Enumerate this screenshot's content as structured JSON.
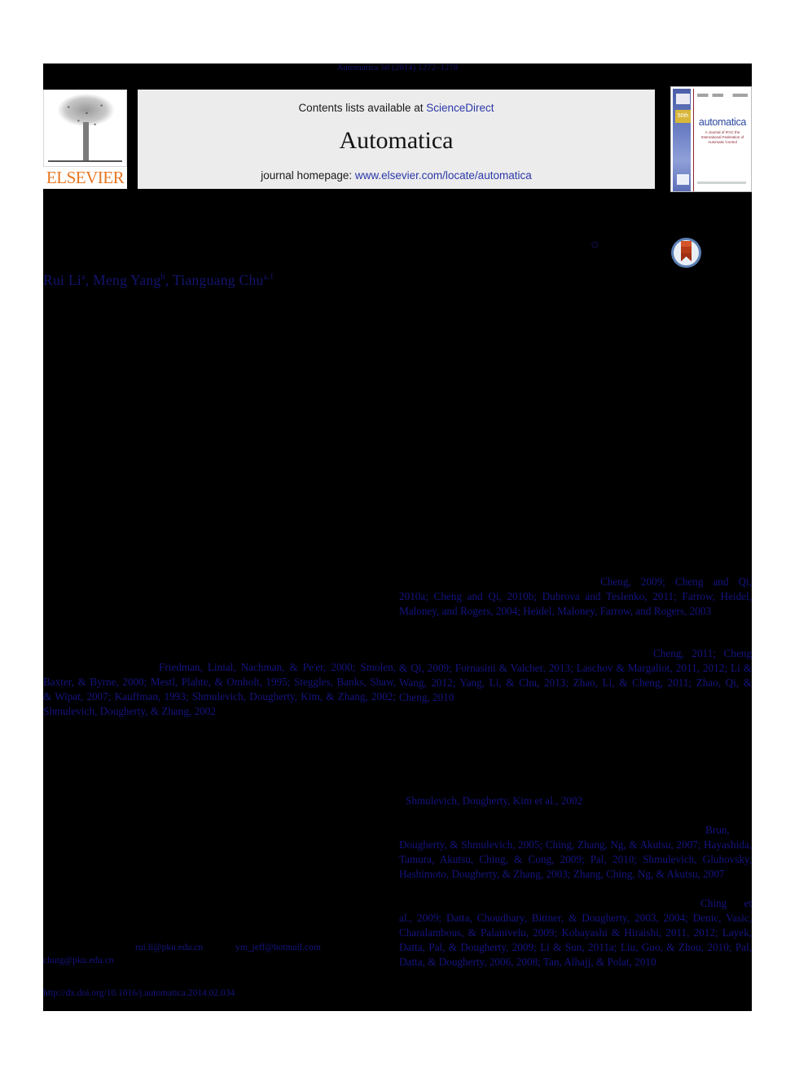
{
  "running_head": "Automatica 50 (2014) 1272–1278",
  "masthead": {
    "contents_prefix": "Contents lists available at ",
    "sciencedirect": "ScienceDirect",
    "journal_title": "Automatica",
    "homepage_prefix": "journal homepage: ",
    "homepage_url": "www.elsevier.com/locate/automatica",
    "publisher_logo_text": "ELSEVIER",
    "cover": {
      "name": "automatica",
      "subtitle": "A Journal of IFAC the International Federation of Automatic Control",
      "anniversary": "50th"
    },
    "colors": {
      "band_background": "#ececec",
      "link_blue": "#2b38a8",
      "elsevier_orange": "#e87722",
      "cover_blue": "#2b48a0"
    }
  },
  "marks": {
    "star_symbol": "✩",
    "crossmark_label": "CrossMark"
  },
  "authors": {
    "a1_name": "Rui Li",
    "a1_sup": "a",
    "a2_name": "Meng Yang",
    "a2_sup": "b",
    "a3_name": "Tianguang Chu",
    "a3_sup": "a,1",
    "separator": ", "
  },
  "citations": {
    "right_block_1": "Cheng, 2009; Cheng and Qi, 2010a; Cheng and Qi, 2010b; Dubrova and Teslenko, 2011; Farrow, Heidel, Maloney, and Rogers, 2004; Heidel, Maloney, Farrow, and Rogers, 2003",
    "right_block_2": "Cheng, 2011; Cheng & Qi, 2009; Fornasini & Valcher, 2013; Laschov & Margaliot, 2011, 2012; Li & Wang, 2012; Yang, Li, & Chu, 2013; Zhao, Li, & Cheng, 2011; Zhao, Qi, & Cheng, 2010",
    "left_block_1": "Friedman, Linial, Nachman, & Pe'er, 2000; Smolen, Baxter, & Byrne, 2000; Mestl, Plahte, & Omholt, 1995; Steggles, Banks, Shaw, & Wipat, 2007; Kauffman, 1993; Shmulevich, Dougherty, Kim, & Zhang, 2002; Shmulevich, Dougherty, & Zhang, 2002",
    "right_block_3": "Shmulevich, Dougherty, Kim et al., 2002",
    "right_block_4": "Brun, Dougherty, & Shmulevich, 2005; Ching, Zhang, Ng, & Akutsu, 2007; Hayashida, Tamura, Akutsu, Ching, & Cong, 2009; Pal, 2010; Shmulevich, Gluhovsky, Hashimoto, Dougherty, & Zhang, 2003; Zhang, Ching, Ng, & Akutsu, 2007",
    "right_block_5": "Ching et al., 2009; Datta, Choudhary, Bittner, & Dougherty, 2003, 2004; Denic, Vasic, Charalambous, & Palanivelu, 2009; Kobayashi & Hiraishi, 2011, 2012; Layek, Datta, Pal, & Dougherty, 2009; Li & Sun, 2011a; Liu, Guo, & Zhou, 2010; Pal, Datta, & Dougherty, 2006, 2008; Tan, Alhajj, & Polat, 2010"
  },
  "footer": {
    "email_1": "rui.li@pku.edu.cn",
    "email_2": "ym_jeff@hotmail.com",
    "email_3": "chutg@pku.edu.cn",
    "doi": "http://dx.doi.org/10.1016/j.automatica.2014.02.034"
  },
  "colors": {
    "redaction_black": "#000000",
    "link_text": "#141480",
    "page_white": "#ffffff"
  }
}
